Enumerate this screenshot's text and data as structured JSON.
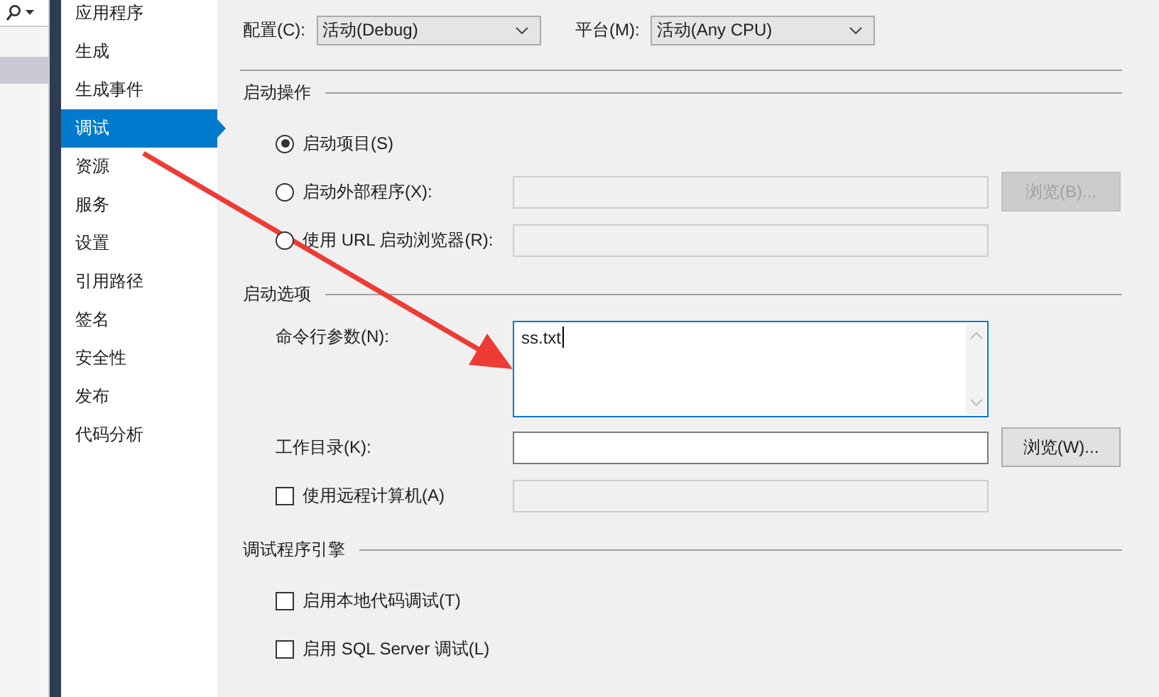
{
  "sidebar": {
    "items": [
      {
        "label": "应用程序",
        "selected": false
      },
      {
        "label": "生成",
        "selected": false
      },
      {
        "label": "生成事件",
        "selected": false
      },
      {
        "label": "调试",
        "selected": true
      },
      {
        "label": "资源",
        "selected": false
      },
      {
        "label": "服务",
        "selected": false
      },
      {
        "label": "设置",
        "selected": false
      },
      {
        "label": "引用路径",
        "selected": false
      },
      {
        "label": "签名",
        "selected": false
      },
      {
        "label": "安全性",
        "selected": false
      },
      {
        "label": "发布",
        "selected": false
      },
      {
        "label": "代码分析",
        "selected": false
      }
    ]
  },
  "configuration": {
    "label": "配置(C):",
    "value": "活动(Debug)"
  },
  "platform": {
    "label": "平台(M):",
    "value": "活动(Any CPU)"
  },
  "sections": [
    {
      "title": "启动操作",
      "rows": [
        {
          "kind": "radio",
          "label": "启动项目(S)",
          "selected": true
        },
        {
          "kind": "radio",
          "label": "启动外部程序(X):",
          "selected": false,
          "field": {
            "kind": "line",
            "disabled": true
          },
          "button": {
            "label": "浏览(B)...",
            "disabled": true
          }
        },
        {
          "kind": "radio",
          "label": "使用 URL 启动浏览器(R):",
          "selected": false,
          "field": {
            "kind": "line",
            "disabled": true
          }
        }
      ]
    },
    {
      "title": "启动选项",
      "rows": [
        {
          "kind": "text",
          "label": "命令行参数(N):",
          "field": {
            "kind": "multiline",
            "value": "ss.txt",
            "disabled": false,
            "focused": true
          }
        },
        {
          "kind": "text",
          "label": "工作目录(K):",
          "field": {
            "kind": "line",
            "disabled": false
          },
          "button": {
            "label": "浏览(W)...",
            "disabled": false
          }
        },
        {
          "kind": "checkbox",
          "label": "使用远程计算机(A)",
          "checked": false,
          "field": {
            "kind": "line",
            "disabled": true
          }
        }
      ]
    },
    {
      "title": "调试程序引擎",
      "rows": [
        {
          "kind": "checkbox",
          "label": "启用本地代码调试(T)",
          "checked": false
        },
        {
          "kind": "checkbox",
          "label": "启用 SQL Server 调试(L)",
          "checked": false
        }
      ]
    }
  ]
}
